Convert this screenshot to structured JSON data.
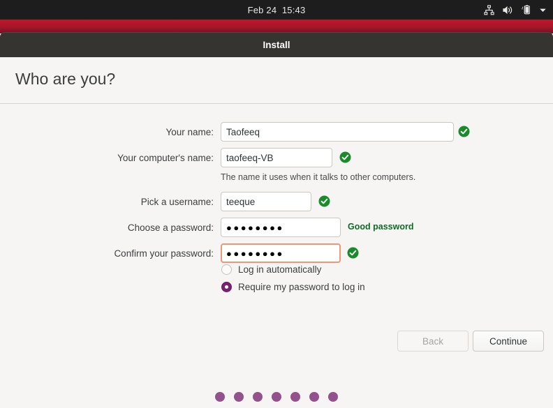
{
  "topbar": {
    "clock": "Feb 24  15:43",
    "indicators": [
      {
        "name": "network-icon",
        "label": "network"
      },
      {
        "name": "volume-icon",
        "label": "volume"
      },
      {
        "name": "battery-charging-icon",
        "label": "battery charging"
      },
      {
        "name": "chevron-down-icon",
        "label": "system menu"
      }
    ]
  },
  "window": {
    "title": "Install"
  },
  "page": {
    "heading": "Who are you?"
  },
  "form": {
    "your_name": {
      "label": "Your name:",
      "value": "Taofeeq",
      "placeholder": "",
      "valid": true
    },
    "computer_name": {
      "label": "Your computer's name:",
      "value": "taofeeq-VB",
      "placeholder": "",
      "hint": "The name it uses when it talks to other computers.",
      "valid": true
    },
    "username": {
      "label": "Pick a username:",
      "value": "teeque",
      "placeholder": "",
      "valid": true
    },
    "password": {
      "label": "Choose a password:",
      "value": "●●●●●●●●",
      "placeholder": "",
      "strength": "Good password"
    },
    "confirm_password": {
      "label": "Confirm your password:",
      "value": "●●●●●●●●",
      "placeholder": "",
      "valid": true,
      "focused": true
    }
  },
  "login_options": {
    "auto_login": {
      "label": "Log in automatically",
      "selected": false
    },
    "require_password": {
      "label": "Require my password to log in",
      "selected": true
    }
  },
  "buttons": {
    "back": {
      "label": "Back",
      "disabled": true
    },
    "continue": {
      "label": "Continue",
      "disabled": false
    }
  },
  "progress": {
    "total_dots": 7,
    "dot_color": "#93528b"
  },
  "colors": {
    "accent_purple": "#77216f",
    "valid_green": "#26a233",
    "focus_orange": "#ed9775",
    "titlebar": "#353430",
    "red_strip": "#a4162a",
    "page_bg": "#f6f5f4"
  }
}
